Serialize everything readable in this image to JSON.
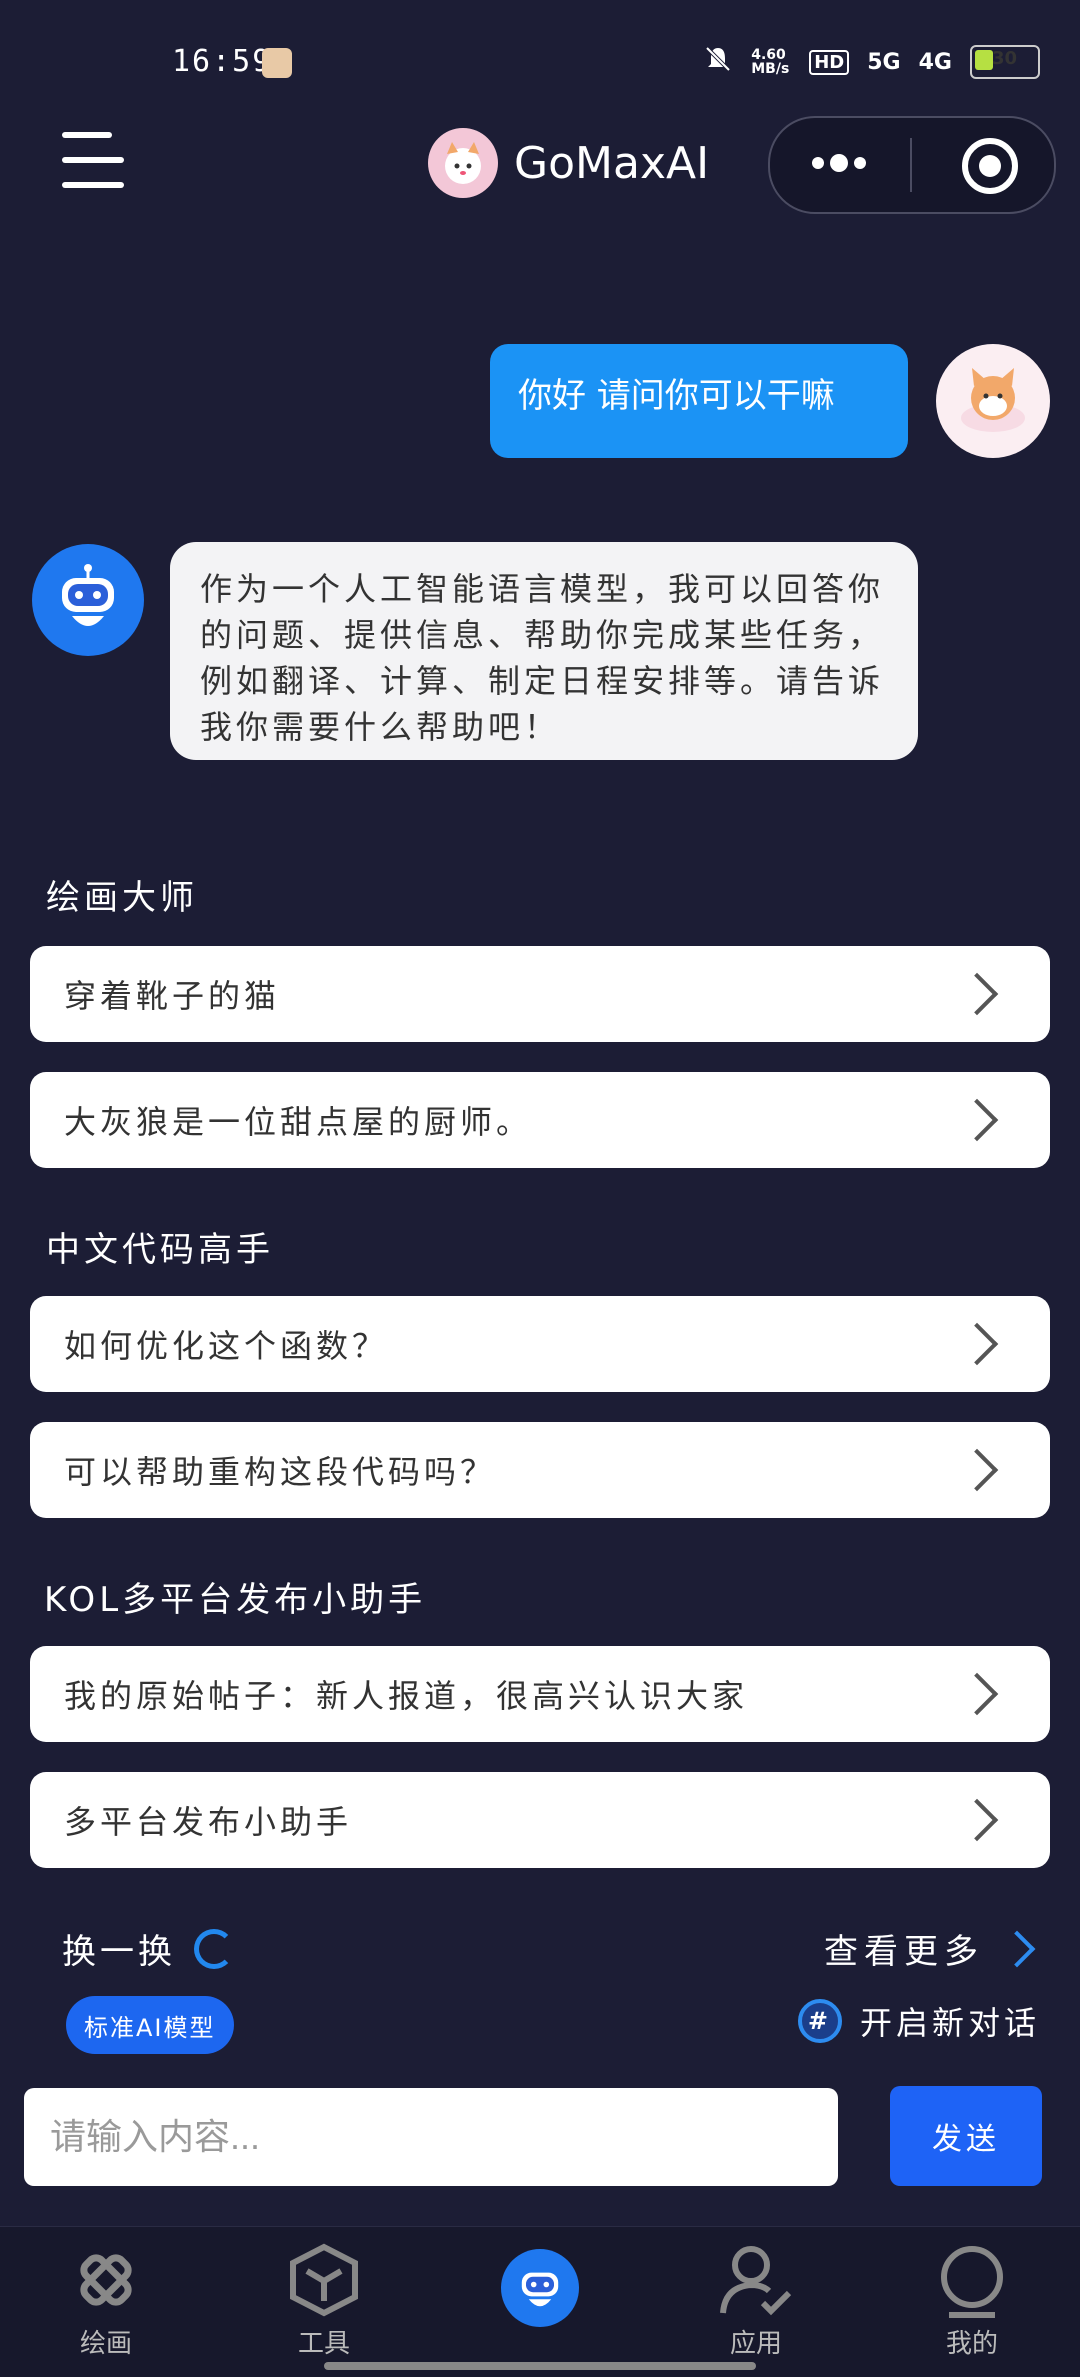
{
  "status_bar": {
    "time": "16:59",
    "net_speed": "4.60 MB/s",
    "hd": "HD",
    "signal_5g": "5G",
    "signal_4g": "4G",
    "battery": "30"
  },
  "header": {
    "title": "GoMaxAI"
  },
  "chat": {
    "user_message": "你好 请问你可以干嘛",
    "bot_message": "作为一个人工智能语言模型，我可以回答你的问题、提供信息、帮助你完成某些任务，例如翻译、计算、制定日程安排等。请告诉我你需要什么帮助吧！"
  },
  "sections": [
    {
      "title": "绘画大师",
      "items": [
        "穿着靴子的猫",
        "大灰狼是一位甜点屋的厨师。"
      ]
    },
    {
      "title": "中文代码高手",
      "items": [
        "如何优化这个函数？",
        "可以帮助重构这段代码吗？"
      ]
    },
    {
      "title": "KOL多平台发布小助手",
      "items": [
        "我的原始帖子：新人报道，很高兴认识大家",
        "多平台发布小助手"
      ]
    }
  ],
  "actions": {
    "swap_label": "换一换",
    "more_label": "查看更多",
    "model_label": "标准AI模型",
    "new_chat_label": "开启新对话",
    "hash_symbol": "#"
  },
  "input": {
    "placeholder": "请输入内容...",
    "send_label": "发送"
  },
  "nav": [
    {
      "label": "绘画",
      "icon": "paint-icon"
    },
    {
      "label": "工具",
      "icon": "cube-icon"
    },
    {
      "label": "",
      "icon": "robot-icon"
    },
    {
      "label": "应用",
      "icon": "user-check-icon"
    },
    {
      "label": "我的",
      "icon": "profile-icon"
    }
  ],
  "colors": {
    "background": "#1c1d35",
    "user_bubble": "#1b93f5",
    "accent": "#1e63f6"
  }
}
